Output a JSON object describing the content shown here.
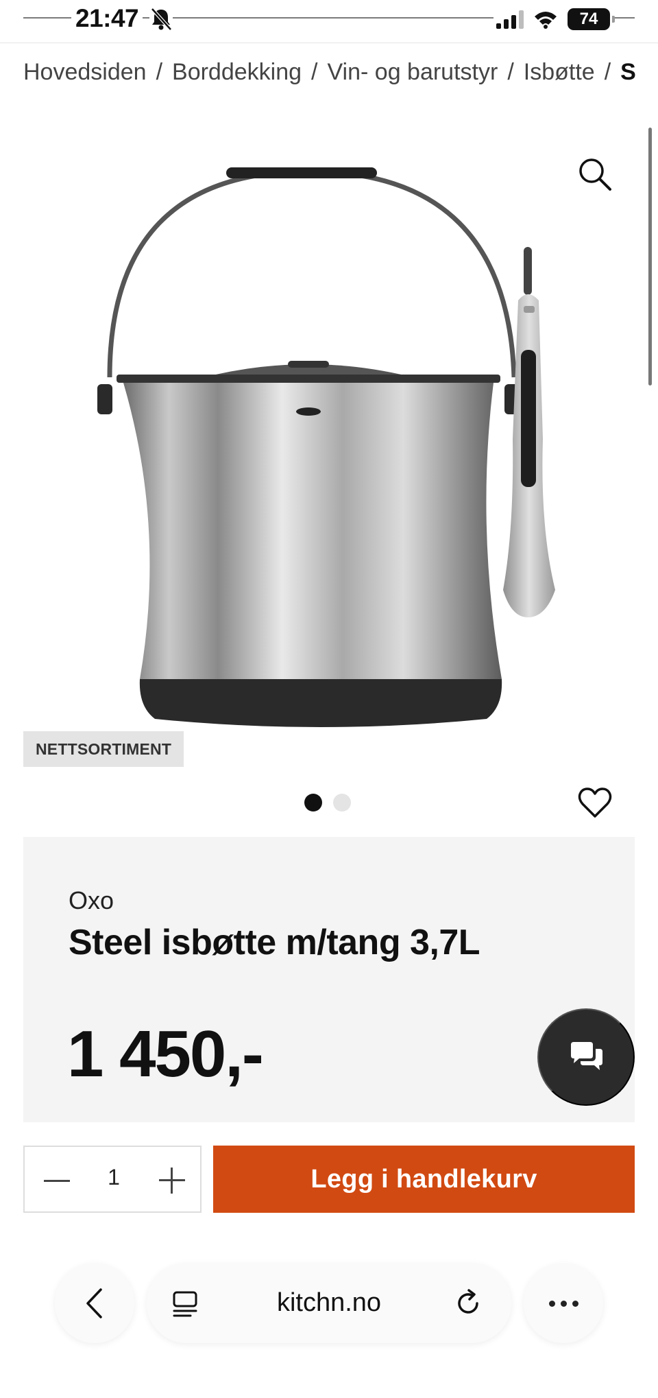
{
  "status_bar": {
    "time": "21:47",
    "battery": "74",
    "icons": [
      "bell-slash-icon",
      "signal-icon",
      "wifi-icon",
      "battery-icon"
    ]
  },
  "breadcrumb": {
    "items": [
      "Hovedsiden",
      "Borddekking",
      "Vin- og barutstyr",
      "Isbøtte",
      "S"
    ],
    "separator": "/"
  },
  "gallery": {
    "badge": "NETTSORTIMENT",
    "slide_count": 2,
    "active_slide": 1
  },
  "product": {
    "brand": "Oxo",
    "title": "Steel isbøtte m/tang 3,7L",
    "price": "1 450,-"
  },
  "purchase": {
    "quantity": "1",
    "cart_label": "Legg i handlekurv"
  },
  "browser": {
    "url": "kitchn.no"
  },
  "colors": {
    "accent": "#d14a12",
    "panel": "#f4f4f4",
    "chat": "#2b2b2b"
  }
}
